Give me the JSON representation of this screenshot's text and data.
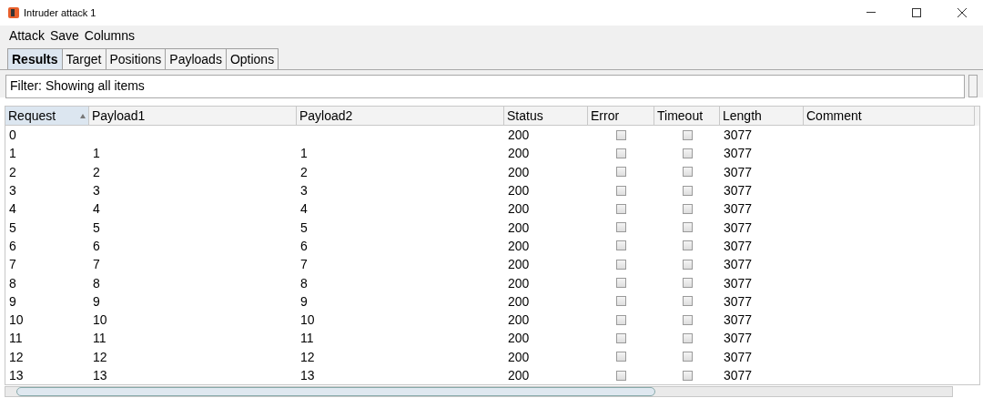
{
  "window": {
    "title": "Intruder attack 1"
  },
  "menu": [
    "Attack",
    "Save",
    "Columns"
  ],
  "tabs": [
    {
      "label": "Results",
      "selected": true
    },
    {
      "label": "Target",
      "selected": false
    },
    {
      "label": "Positions",
      "selected": false
    },
    {
      "label": "Payloads",
      "selected": false
    },
    {
      "label": "Options",
      "selected": false
    }
  ],
  "filter": "Filter: Showing all items",
  "table": {
    "columns": [
      {
        "label": "Request",
        "sorted": true
      },
      {
        "label": "Payload1",
        "sorted": false
      },
      {
        "label": "Payload2",
        "sorted": false
      },
      {
        "label": "Status",
        "sorted": false
      },
      {
        "label": "Error",
        "sorted": false
      },
      {
        "label": "Timeout",
        "sorted": false
      },
      {
        "label": "Length",
        "sorted": false
      },
      {
        "label": "Comment",
        "sorted": false
      }
    ],
    "rows": [
      {
        "request": "0",
        "status": "200",
        "error": false,
        "timeout": false,
        "length": "3077"
      },
      {
        "request": "1",
        "payload1": "1",
        "payload2": "1",
        "status": "200",
        "error": false,
        "timeout": false,
        "length": "3077"
      },
      {
        "request": "2",
        "payload1": "2",
        "payload2": "2",
        "status": "200",
        "error": false,
        "timeout": false,
        "length": "3077"
      },
      {
        "request": "3",
        "payload1": "3",
        "payload2": "3",
        "status": "200",
        "error": false,
        "timeout": false,
        "length": "3077"
      },
      {
        "request": "4",
        "payload1": "4",
        "payload2": "4",
        "status": "200",
        "error": false,
        "timeout": false,
        "length": "3077"
      },
      {
        "request": "5",
        "payload1": "5",
        "payload2": "5",
        "status": "200",
        "error": false,
        "timeout": false,
        "length": "3077"
      },
      {
        "request": "6",
        "payload1": "6",
        "payload2": "6",
        "status": "200",
        "error": false,
        "timeout": false,
        "length": "3077"
      },
      {
        "request": "7",
        "payload1": "7",
        "payload2": "7",
        "status": "200",
        "error": false,
        "timeout": false,
        "length": "3077"
      },
      {
        "request": "8",
        "payload1": "8",
        "payload2": "8",
        "status": "200",
        "error": false,
        "timeout": false,
        "length": "3077"
      },
      {
        "request": "9",
        "payload1": "9",
        "payload2": "9",
        "status": "200",
        "error": false,
        "timeout": false,
        "length": "3077"
      },
      {
        "request": "10",
        "payload1": "10",
        "payload2": "10",
        "status": "200",
        "error": false,
        "timeout": false,
        "length": "3077"
      },
      {
        "request": "11",
        "payload1": "11",
        "payload2": "11",
        "status": "200",
        "error": false,
        "timeout": false,
        "length": "3077"
      },
      {
        "request": "12",
        "payload1": "12",
        "payload2": "12",
        "status": "200",
        "error": false,
        "timeout": false,
        "length": "3077"
      },
      {
        "request": "13",
        "payload1": "13",
        "payload2": "13",
        "status": "200",
        "error": false,
        "timeout": false,
        "length": "3077"
      }
    ]
  }
}
